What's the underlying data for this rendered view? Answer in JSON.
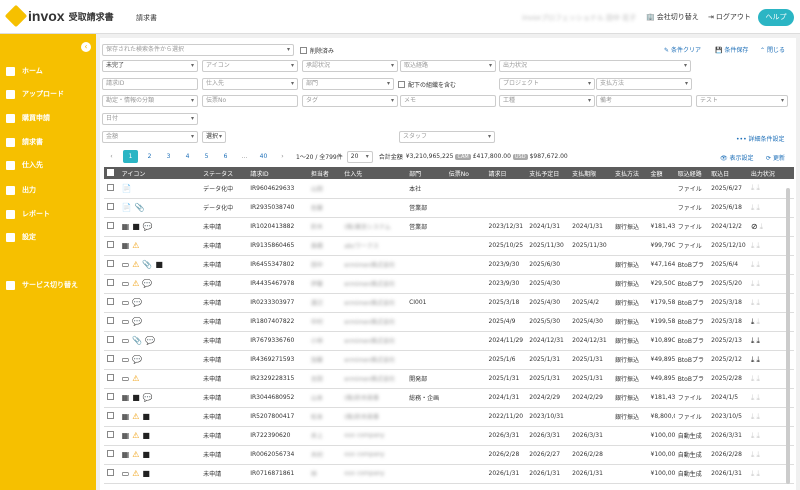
{
  "app": {
    "brand": "invox",
    "product": "受取請求書",
    "page": "請求書",
    "user": "invoxプロフェッショナル 田中 花子",
    "switch_company": "会社切り替え",
    "logout": "ログアウト",
    "help": "ヘルプ"
  },
  "sidebar": {
    "items": [
      {
        "label": "ホーム"
      },
      {
        "label": "アップロード"
      },
      {
        "label": "購買申請"
      },
      {
        "label": "請求書"
      },
      {
        "label": "仕入先"
      },
      {
        "label": "出力"
      },
      {
        "label": "レポート"
      },
      {
        "label": "設定"
      },
      {
        "label": "サービス切り替え"
      }
    ]
  },
  "filters": {
    "saved_search": "保存された検索条件から選択",
    "deleted": "削除済み",
    "clear": "条件クリア",
    "save": "条件保存",
    "close": "閉じる",
    "status": "未完了",
    "icon": "アイコン",
    "approval": "承認状況",
    "route": "取込経路",
    "output": "出力状況",
    "invoice_id": "請求ID",
    "vendor": "仕入先",
    "dept": "部門",
    "sub_org": "配下の組織を含む",
    "project": "プロジェクト",
    "pay_method": "支払方法",
    "acct": "勘定・情報の分類",
    "slip": "伝票No",
    "tag": "タグ",
    "memo": "メモ",
    "process": "工種",
    "note": "備考",
    "test": "テスト",
    "date": "日付",
    "amount": "金額",
    "choose": "選択",
    "staff": "スタッフ",
    "detail": "詳細条件設定"
  },
  "pager": {
    "pages": [
      "1",
      "2",
      "3",
      "4",
      "5",
      "6",
      "...",
      "40"
    ],
    "range": "1〜20 / 全799件",
    "per_page": "20",
    "total_label": "合計金額",
    "total": "¥3,210,965,225",
    "tag1": "CAM",
    "amt1": "£417,800.00",
    "tag2": "USD",
    "amt2": "$987,672.00",
    "view_settings": "表示設定",
    "refresh": "更新"
  },
  "table": {
    "headers": [
      "",
      "アイコン",
      "ステータス",
      "請求ID",
      "担当者",
      "仕入先",
      "部門",
      "伝票No",
      "請求日",
      "支払予定日",
      "支払期限",
      "支払方法",
      "金額",
      "取込経路",
      "取込日",
      "出力状況"
    ],
    "rows": [
      {
        "icons": "📄",
        "status": "データ化中",
        "id": "IR9604629633",
        "staff": "山田",
        "vendor": "",
        "dept": "本社",
        "date": "",
        "due": "",
        "deadline": "",
        "method": "",
        "amount": "",
        "route": "ファイル",
        "recv": "2025/6/27",
        "out": "g"
      },
      {
        "icons": "📄 📎",
        "status": "データ化中",
        "id": "IR2935038740",
        "staff": "佐藤",
        "vendor": "",
        "dept": "営業部",
        "date": "",
        "due": "",
        "deadline": "",
        "method": "",
        "amount": "",
        "route": "ファイル",
        "recv": "2025/6/18",
        "out": "g"
      },
      {
        "icons": "▦ ■ 💬",
        "status": "未申請",
        "id": "IR1020413882",
        "staff": "鈴木",
        "vendor": "(株)東京システム",
        "dept": "営業部",
        "date": "2023/12/31",
        "due": "2024/1/31",
        "deadline": "2024/1/31",
        "method": "銀行振込",
        "amount": "¥181,43",
        "route": "ファイル",
        "recv": "2024/12/2",
        "out": "x"
      },
      {
        "icons": "▦ ⚠",
        "status": "未申請",
        "id": "IR9135860465",
        "staff": "高橋",
        "vendor": "abcワークス",
        "dept": "",
        "date": "2025/10/25",
        "due": "2025/11/30",
        "deadline": "2025/11/30",
        "method": "",
        "amount": "¥99,79C",
        "route": "ファイル",
        "recv": "2025/12/10",
        "out": "g"
      },
      {
        "icons": "▭ ⚠ 📎 ■",
        "status": "未申請",
        "id": "IR6455347802",
        "staff": "田中",
        "vendor": "ermimen株式会社",
        "dept": "",
        "date": "2023/9/30",
        "due": "2025/6/30",
        "deadline": "",
        "method": "銀行振込",
        "amount": "¥47,164",
        "route": "BtoBプラ",
        "recv": "2025/6/4",
        "out": "g"
      },
      {
        "icons": "▭ ⚠ 💬",
        "status": "未申請",
        "id": "IR4435467978",
        "staff": "伊藤",
        "vendor": "ermimen株式会社",
        "dept": "",
        "date": "2023/9/30",
        "due": "2025/4/30",
        "deadline": "",
        "method": "銀行振込",
        "amount": "¥29,50C",
        "route": "BtoBプラ",
        "recv": "2025/5/20",
        "out": "g"
      },
      {
        "icons": "▭ 💬",
        "status": "未申請",
        "id": "IR0233303977",
        "staff": "渡辺",
        "vendor": "ermimen株式会社",
        "dept": "CI001",
        "date": "2025/3/18",
        "due": "2025/4/30",
        "deadline": "2025/4/2",
        "method": "銀行振込",
        "amount": "¥179,58",
        "route": "BtoBプラ",
        "recv": "2025/3/18",
        "out": "g"
      },
      {
        "icons": "▭ 💬",
        "status": "未申請",
        "id": "IR1807407822",
        "staff": "中村",
        "vendor": "ermimen株式会社",
        "dept": "",
        "date": "2025/4/9",
        "due": "2025/5/30",
        "deadline": "2025/4/30",
        "method": "銀行振込",
        "amount": "¥199,58",
        "route": "BtoBプラ",
        "recv": "2025/3/18",
        "out": "d"
      },
      {
        "icons": "▭ 📎 💬",
        "status": "未申請",
        "id": "IR7679336760",
        "staff": "小林",
        "vendor": "ermimen株式会社",
        "dept": "",
        "date": "2024/11/29",
        "due": "2024/12/31",
        "deadline": "2024/12/31",
        "method": "銀行振込",
        "amount": "¥10,89C",
        "route": "BtoBプラ",
        "recv": "2025/2/13",
        "out": "dd"
      },
      {
        "icons": "▭ 💬",
        "status": "未申請",
        "id": "IR4369271593",
        "staff": "加藤",
        "vendor": "ermimen株式会社",
        "dept": "",
        "date": "2025/1/6",
        "due": "2025/1/31",
        "deadline": "2025/1/31",
        "method": "銀行振込",
        "amount": "¥49,895",
        "route": "BtoBプラ",
        "recv": "2025/2/12",
        "out": "dd"
      },
      {
        "icons": "▭ ⚠",
        "status": "未申請",
        "id": "IR2329228315",
        "staff": "吉田",
        "vendor": "ermimen株式会社",
        "dept": "開発部",
        "date": "2025/1/31",
        "due": "2025/1/31",
        "deadline": "2025/1/31",
        "method": "銀行振込",
        "amount": "¥49,895",
        "route": "BtoBプラ",
        "recv": "2025/2/28",
        "out": "g"
      },
      {
        "icons": "▦ ■ 💬",
        "status": "未申請",
        "id": "IR3044680952",
        "staff": "山本",
        "vendor": "(株)鈴木商事",
        "dept": "総務・企画",
        "date": "2024/1/31",
        "due": "2024/2/29",
        "deadline": "2024/2/29",
        "method": "銀行振込",
        "amount": "¥181,43",
        "route": "ファイル",
        "recv": "2024/1/5",
        "out": "g"
      },
      {
        "icons": "▦ ⚠ ■",
        "status": "未申請",
        "id": "IR5207800417",
        "staff": "松本",
        "vendor": "(株)鈴木商事",
        "dept": "",
        "date": "2022/11/20",
        "due": "2023/10/31",
        "deadline": "",
        "method": "銀行振込",
        "amount": "¥8,800,C",
        "route": "ファイル",
        "recv": "2023/10/5",
        "out": "g"
      },
      {
        "icons": "▦ ⚠ ■",
        "status": "未申請",
        "id": "IR722390620",
        "staff": "井上",
        "vendor": "xxx company",
        "dept": "",
        "date": "2026/3/31",
        "due": "2026/3/31",
        "deadline": "2026/3/31",
        "method": "",
        "amount": "¥100,00",
        "route": "自動生成",
        "recv": "2026/3/31",
        "out": "g"
      },
      {
        "icons": "▦ ⚠ ■",
        "status": "未申請",
        "id": "IR0062056734",
        "staff": "木村",
        "vendor": "xxx company",
        "dept": "",
        "date": "2026/2/28",
        "due": "2026/2/27",
        "deadline": "2026/2/28",
        "method": "",
        "amount": "¥100,00",
        "route": "自動生成",
        "recv": "2026/2/28",
        "out": "g"
      },
      {
        "icons": "▭ ⚠ ■",
        "status": "未申請",
        "id": "IR0716871861",
        "staff": "林",
        "vendor": "xxx company",
        "dept": "",
        "date": "2026/1/31",
        "due": "2026/1/31",
        "deadline": "2026/1/31",
        "method": "",
        "amount": "¥100,00",
        "route": "自動生成",
        "recv": "2026/1/31",
        "out": "g"
      }
    ]
  }
}
